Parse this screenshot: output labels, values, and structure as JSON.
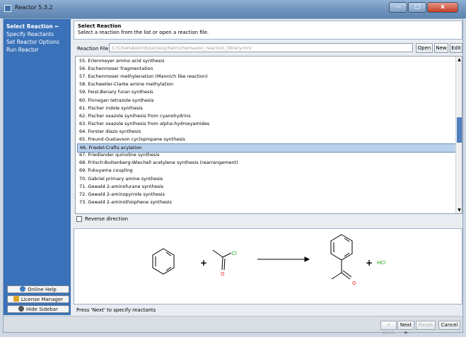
{
  "window": {
    "title": "Reactor 5.3.2",
    "minimize_glyph": "—",
    "maximize_glyph": "□",
    "close_glyph": "x"
  },
  "sidebar": {
    "steps": [
      {
        "label": "Select Reaction ←",
        "active": true
      },
      {
        "label": "Specify Reactants",
        "active": false
      },
      {
        "label": "Set Reactor Options",
        "active": false
      },
      {
        "label": "Run Reactor",
        "active": false
      }
    ],
    "buttons": {
      "online_help": "Online Help",
      "license_manager": "License Manager",
      "hide_sidebar": "Hide Sidebar"
    }
  },
  "header": {
    "title": "Select Reaction",
    "description": "Select a reaction from the list or open a reaction file."
  },
  "reaction_file": {
    "label": "Reaction File:",
    "value": "C:\\ChemAxon\\Sources\\jchem\\chemaxon_reaction_library.mrv",
    "buttons": {
      "open": "Open",
      "new": "New",
      "edit": "Edit"
    }
  },
  "reactions": [
    "55. Erlenmeyer amino acid synthesis",
    "56. Eschenmoser fragmentation",
    "57. Eschenmoser methylenation (Mannich like reaction)",
    "58. Eschweiler-Clarke amine methylation",
    "59. Feist-Benary furan synthesis",
    "60. Finnegan tetrazole synthesis",
    "61. Fischer indole synthesis",
    "62. Fischer oxazole synthesis from cyanohydrins",
    "63. Fischer oxazole synthesis from alpha-hydroxyamides",
    "64. Forster diazo synthesis",
    "65. Freund-Gustavson cyclopropane synthesis",
    "66. Friedel-Crafts acylation",
    "67. Friedlander quinoline synthesis",
    "68. Fritsch-Buttenberg-Wiechell acetylene synthesis (rearrangement)",
    "69. Fukuyama coupling",
    "70. Gabriel primary amine synthesis",
    "71. Gewald 2-aminofurane synthesis",
    "72. Gewald 2-aminopyrrole synthesis",
    "73. Gewald 2-aminothiophene synthesis"
  ],
  "selected_index": 11,
  "reverse_direction": {
    "label": "Reverse direction",
    "checked": false
  },
  "preview": {
    "plus": "+",
    "cl_label": "Cl",
    "o_label": "O",
    "hcl_label": "HCl",
    "colors": {
      "oxygen": "#e8241b",
      "chlorine": "#1aa51a",
      "bond": "#000000"
    }
  },
  "status": "Press 'Next' to specify reactants",
  "footer": {
    "back": "< Back",
    "next": "Next >",
    "finish": "Finish",
    "cancel": "Cancel"
  }
}
